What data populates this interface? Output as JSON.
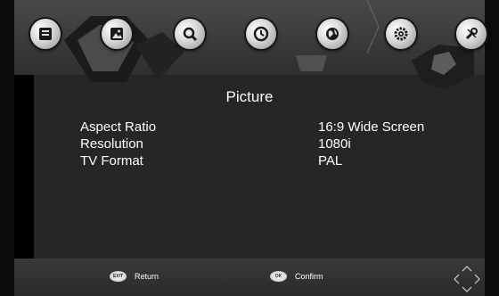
{
  "menu": {
    "items": [
      {
        "name": "tv-list",
        "icon": "tv-list-icon"
      },
      {
        "name": "picture",
        "icon": "picture-icon"
      },
      {
        "name": "search",
        "icon": "search-icon"
      },
      {
        "name": "time",
        "icon": "clock-icon"
      },
      {
        "name": "language",
        "icon": "globe-icon"
      },
      {
        "name": "system",
        "icon": "gear-icon"
      },
      {
        "name": "tools",
        "icon": "tools-icon"
      }
    ]
  },
  "page": {
    "title": "Picture"
  },
  "settings": [
    {
      "label": "Aspect Ratio",
      "value": "16:9 Wide Screen"
    },
    {
      "label": "Resolution",
      "value": "1080i"
    },
    {
      "label": "TV Format",
      "value": "PAL"
    }
  ],
  "footer": {
    "exit_badge": "EXIT",
    "return_label": "Return",
    "ok_badge": "OK",
    "confirm_label": "Confirm"
  },
  "colors": {
    "background": "#000000",
    "panel": "#262626",
    "text": "#ffffff",
    "icon": "#d6d6d6"
  }
}
